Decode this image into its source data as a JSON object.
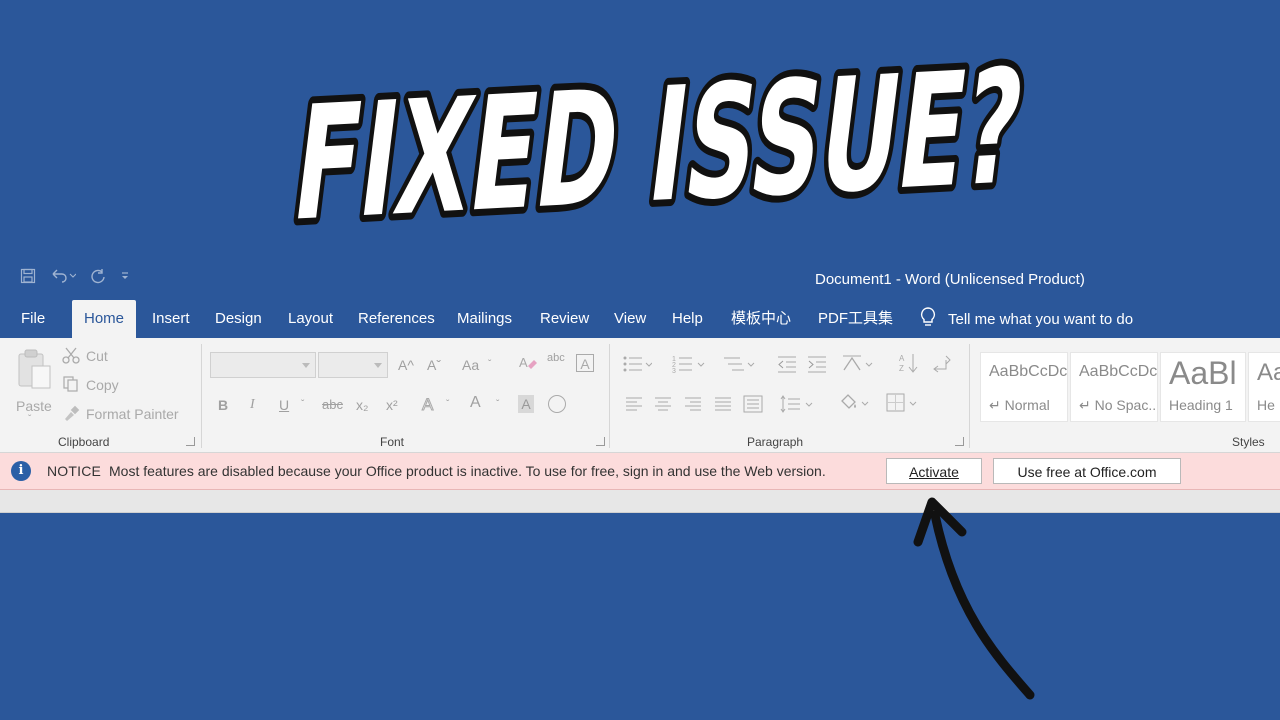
{
  "headline": {
    "text": "FIXED ISSUE?"
  },
  "titlebar": {
    "doc_title": "Document1  -  Word (Unlicensed Product)"
  },
  "menu": {
    "tabs": [
      "File",
      "Home",
      "Insert",
      "Design",
      "Layout",
      "References",
      "Mailings",
      "Review",
      "View",
      "Help",
      "模板中心",
      "PDF工具集"
    ],
    "active_tab": "Home",
    "tell_me": "Tell me what you want to do"
  },
  "ribbon": {
    "clipboard": {
      "label": "Clipboard",
      "paste": "Paste",
      "cut": "Cut",
      "copy": "Copy",
      "format_painter": "Format Painter"
    },
    "font": {
      "label": "Font",
      "grow_symbol": "A^",
      "shrink_symbol": "Aˇ",
      "case_symbol": "Aa",
      "clear_symbol": "abc",
      "bold": "B",
      "italic": "I",
      "underline": "U",
      "strike": "abc",
      "subscript": "x₂",
      "superscript": "x²",
      "effects": "A",
      "font_color": "A"
    },
    "paragraph": {
      "label": "Paragraph"
    },
    "styles": {
      "label": "Styles",
      "items": [
        {
          "sample": "AaBbCcDc",
          "name": "↵ Normal"
        },
        {
          "sample": "AaBbCcDc",
          "name": "↵ No Spac..."
        },
        {
          "sample": "AaBl",
          "name": "Heading 1"
        },
        {
          "sample": "Aa",
          "name": "He"
        }
      ]
    }
  },
  "notice": {
    "icon_glyph": "i",
    "label": "NOTICE",
    "message": "Most features are disabled because your Office product is inactive. To use for free, sign in and use the Web version.",
    "activate": "Activate",
    "web": "Use free at Office.com"
  }
}
